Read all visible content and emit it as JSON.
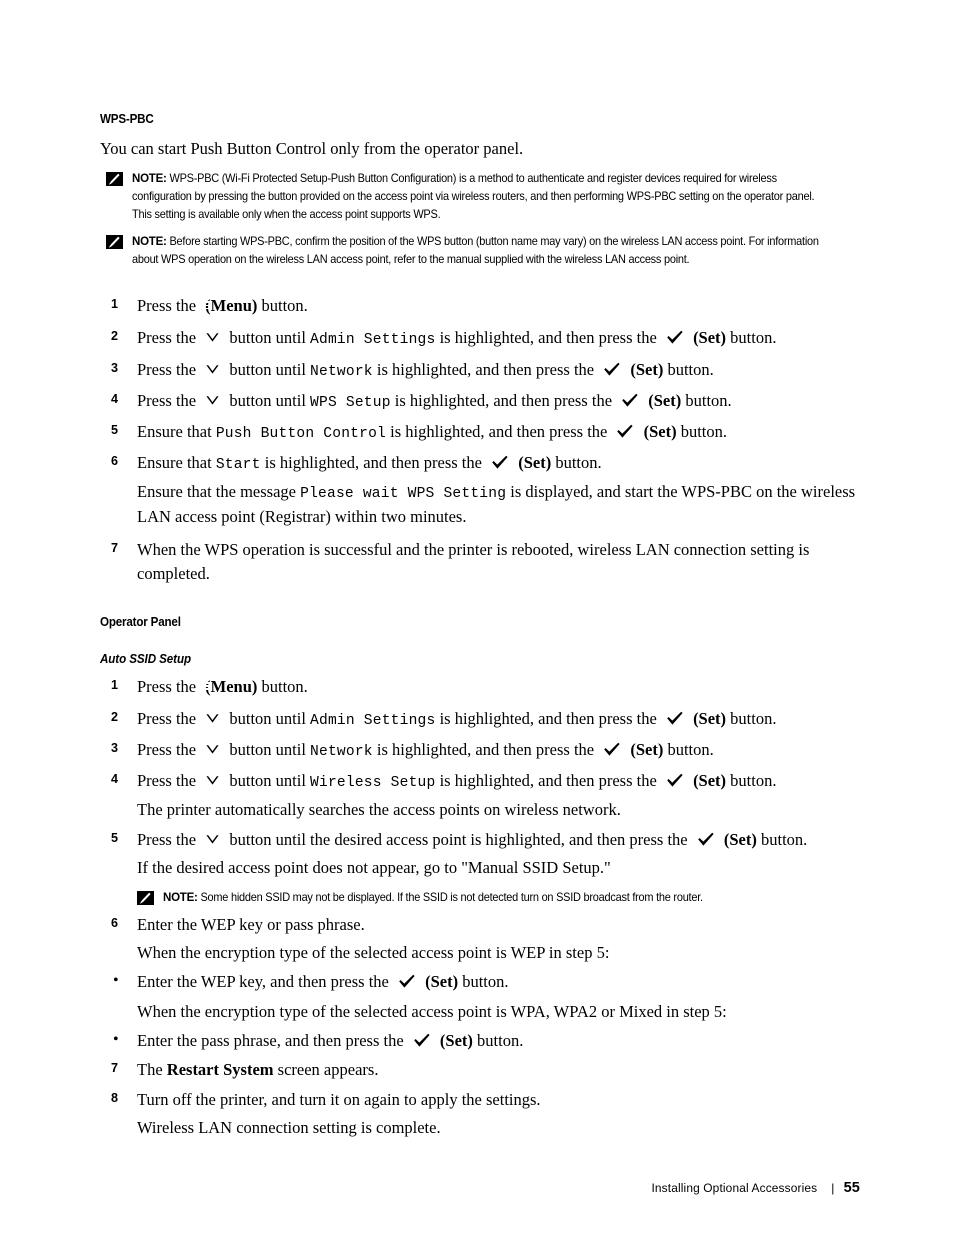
{
  "document": {
    "section_title": "WPS-PBC",
    "intro": "You can start Push Button Control only from the operator panel.",
    "notes": [
      {
        "label": "NOTE:",
        "text": "WPS-PBC (Wi-Fi Protected Setup-Push Button Configuration) is a method to authenticate and register devices required for wireless configuration by pressing the button provided on the access point via wireless routers, and then performing WPS-PBC setting on the operator panel. This setting is available only when the access point supports WPS."
      },
      {
        "label": "NOTE:",
        "text": "Before starting WPS-PBC, confirm the position of the WPS button (button name may vary) on the wireless LAN access point. For information about WPS operation on the wireless LAN access point, refer to the manual supplied with the wireless LAN access point."
      }
    ],
    "wps_steps": [
      {
        "num": "1",
        "pre": "Press the",
        "icon": "menu-icon",
        "post_label": "(Menu)",
        "post": "button."
      },
      {
        "num": "2",
        "pre": "Press the",
        "icon": "chevron-down-icon",
        "mid": "button until",
        "mono": "Admin Settings",
        "mid2": "is highlighted, and then press the",
        "icon2": "check-icon",
        "post_label": "(Set)",
        "post": "button."
      },
      {
        "num": "3",
        "pre": "Press the",
        "icon": "chevron-down-icon",
        "mid": "button until",
        "mono": "Network",
        "mid2": "is highlighted, and then press the",
        "icon2": "check-icon",
        "post_label": "(Set)",
        "post": "button."
      },
      {
        "num": "4",
        "pre": "Press the",
        "icon": "chevron-down-icon",
        "mid": "button until",
        "mono": "WPS Setup",
        "mid2": "is highlighted, and then press the",
        "icon2": "check-icon",
        "post_label": "(Set)",
        "post": "button."
      },
      {
        "num": "5",
        "pre": "Ensure that",
        "mono": "Push Button Control",
        "mid2": "is highlighted, and then press the",
        "icon2": "check-icon",
        "post_label": "(Set)",
        "post": "button."
      },
      {
        "num": "6",
        "pre": "Ensure that",
        "mono": "Start",
        "mid2": "is highlighted, and then press the",
        "icon2": "check-icon",
        "post_label": "(Set)",
        "post": "button.",
        "cont_pre": "Ensure that the message",
        "cont_mono": "Please wait WPS Setting",
        "cont_post": "is displayed, and start the WPS-PBC on the wireless LAN access point (Registrar) within two minutes."
      },
      {
        "num": "7",
        "plain": "When the WPS operation is successful and the printer is rebooted, wireless LAN connection setting is completed."
      }
    ],
    "operator_panel_heading": "Operator Panel",
    "auto_ssid_heading": "Auto SSID Setup",
    "ssid_steps": [
      {
        "num": "1",
        "pre": "Press the",
        "icon": "menu-icon",
        "post_label": "(Menu)",
        "post": "button."
      },
      {
        "num": "2",
        "pre": "Press the",
        "icon": "chevron-down-icon",
        "mid": "button until",
        "mono": "Admin Settings",
        "mid2": "is highlighted, and then press the",
        "icon2": "check-icon",
        "post_label": "(Set)",
        "post": "button."
      },
      {
        "num": "3",
        "pre": "Press the",
        "icon": "chevron-down-icon",
        "mid": "button until",
        "mono": "Network",
        "mid2": "is highlighted, and then press the",
        "icon2": "check-icon",
        "post_label": "(Set)",
        "post": "button."
      },
      {
        "num": "4",
        "pre": "Press the",
        "icon": "chevron-down-icon",
        "mid": "button until",
        "mono": "Wireless Setup",
        "mid2": "is highlighted, and then press the",
        "icon2": "check-icon",
        "post_label": "(Set)",
        "post": "button.",
        "cont_plain": "The printer automatically searches the access points on wireless network."
      },
      {
        "num": "5",
        "pre": "Press the",
        "icon": "chevron-down-icon",
        "mid_plain": "button until the desired access point  is highlighted, and then press the",
        "icon2": "check-icon",
        "post_label": "(Set)",
        "post": "button.",
        "cont_plain": "If  the desired access point does not appear,  go to \"Manual SSID Setup.\"",
        "note": {
          "label": "NOTE:",
          "text": "Some hidden SSID may not be displayed. If the SSID is not detected turn on SSID broadcast from the router."
        }
      },
      {
        "num": "6",
        "plain": "Enter the WEP key or pass phrase.",
        "wep_intro": "When the encryption type of the selected access point is WEP in step 5:",
        "wep_bullet_pre": "Enter the WEP key, and then press the",
        "wep_bullet_label": "(Set)",
        "wep_bullet_post": "button.",
        "wpa_intro": "When the encryption type of the selected access point is WPA, WPA2 or Mixed in step 5:",
        "wpa_bullet_pre": "Enter the pass phrase, and then press the",
        "wpa_bullet_label": "(Set)",
        "wpa_bullet_post": "button."
      },
      {
        "num": "7",
        "pre_plain": "The",
        "bold": "Restart System",
        "post_plain": "screen appears."
      },
      {
        "num": "8",
        "plain": "Turn off the printer, and turn it on again to apply the settings.",
        "cont_plain": "Wireless LAN connection setting is complete."
      }
    ]
  },
  "footer": {
    "title": "Installing Optional Accessories",
    "separator": "|",
    "page_number": "55"
  }
}
